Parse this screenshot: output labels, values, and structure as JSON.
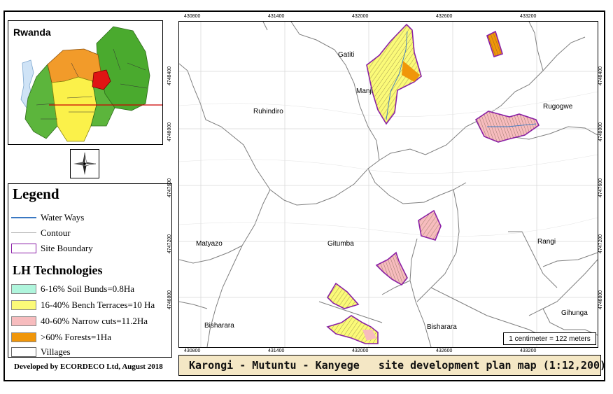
{
  "inset": {
    "title": "Rwanda"
  },
  "legend": {
    "title": "Legend",
    "items": [
      {
        "label": "Water Ways",
        "symbol": "line",
        "color": "#3a78c2"
      },
      {
        "label": "Contour",
        "symbol": "line",
        "color": "#b5b5b5"
      },
      {
        "label": "Site Boundary",
        "symbol": "box",
        "color": "#8b1fa8"
      }
    ],
    "lh_title": "LH Technologies",
    "lh_items": [
      {
        "label": "6-16% Soil Bunds=0.8Ha",
        "color": "#aff5dc"
      },
      {
        "label": "16-40% Bench Terraces=10 Ha",
        "color": "#fbfa78"
      },
      {
        "label": "40-60% Narrow cuts=11.2Ha",
        "color": "#f7bcbe"
      },
      {
        "label": ">60% Forests=1Ha",
        "color": "#f0960a"
      },
      {
        "label": "Villages",
        "color": "#ffffff"
      }
    ]
  },
  "credit": "Developed by ECORDECO Ltd, August 2018",
  "map": {
    "x_ticks": [
      "430800",
      "431400",
      "432000",
      "432600",
      "433200"
    ],
    "y_ticks": [
      "4748400",
      "4748000",
      "4747600",
      "4747200",
      "4746800"
    ],
    "places": {
      "gatiti": "Gatiti",
      "manji": "Manji",
      "ruhindiro": "Ruhindiro",
      "rugogwe": "Rugogwe",
      "matyazo": "Matyazo",
      "gitumba": "Gitumba",
      "rangi": "Rangi",
      "bisharara_left": "Bisharara",
      "bisharara_right": "Bisharara",
      "gihunga": "Gihunga"
    },
    "scale_text": "1 centimeter = 122 meters"
  },
  "title": "Karongi - Mutuntu - Kanyege   site development plan map (1:12,200)"
}
